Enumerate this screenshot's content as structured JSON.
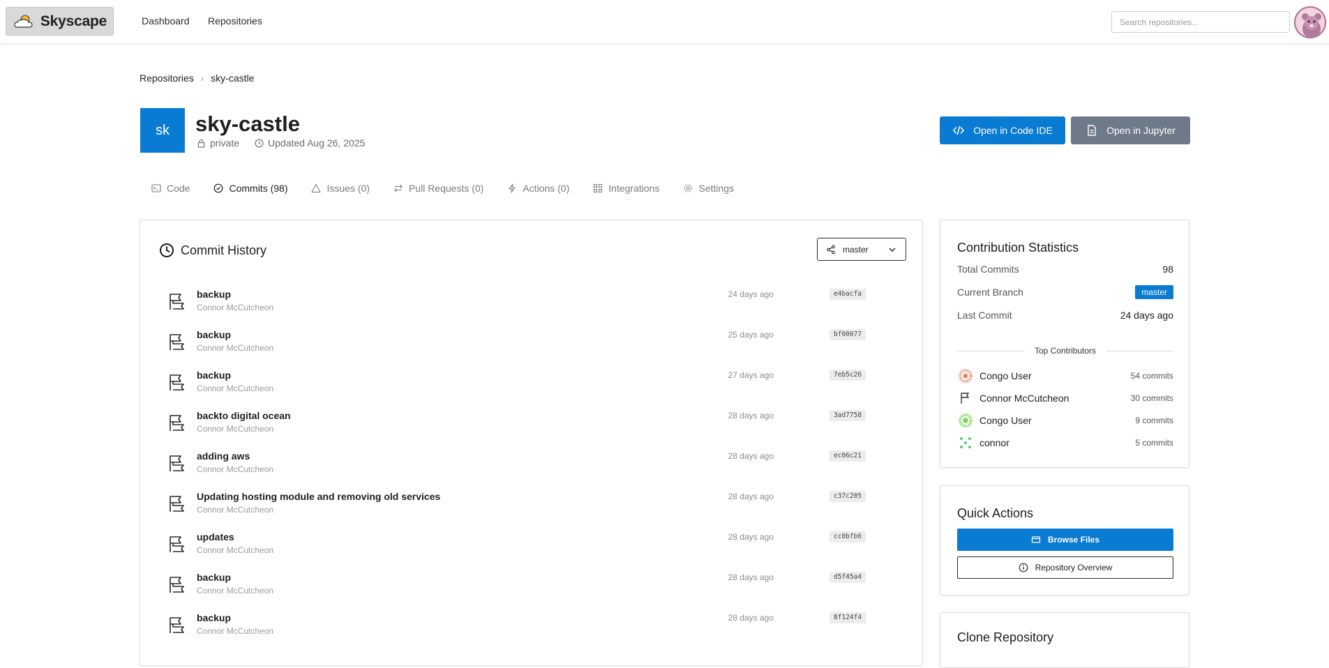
{
  "app": {
    "name": "Skyscape"
  },
  "nav": {
    "items": [
      {
        "label": "Dashboard"
      },
      {
        "label": "Repositories"
      }
    ],
    "search_placeholder": "Search repositories..."
  },
  "breadcrumb": {
    "parent": "Repositories",
    "separator": "›",
    "current": "sky-castle"
  },
  "repo": {
    "initials": "sk",
    "name": "sky-castle",
    "visibility": "private",
    "updated": "Updated Aug 26, 2025",
    "actions": {
      "ide_label": "Open in Code IDE",
      "jupyter_label": "Open in Jupyter"
    }
  },
  "tabs": [
    {
      "label": "Code",
      "icon": "terminal-icon"
    },
    {
      "label": "Commits (98)",
      "icon": "check-circle-icon",
      "active": true
    },
    {
      "label": "Issues (0)",
      "icon": "warning-icon"
    },
    {
      "label": "Pull Requests (0)",
      "icon": "arrows-icon"
    },
    {
      "label": "Actions (0)",
      "icon": "bolt-icon"
    },
    {
      "label": "Integrations",
      "icon": "grid-icon"
    },
    {
      "label": "Settings",
      "icon": "gear-icon"
    }
  ],
  "commit_history": {
    "title": "Commit History",
    "branch": "master",
    "commits": [
      {
        "message": "backup",
        "author": "Connor McCutcheon",
        "time": "24 days ago",
        "sha": "e4bacfa"
      },
      {
        "message": "backup",
        "author": "Connor McCutcheon",
        "time": "25 days ago",
        "sha": "bf00077"
      },
      {
        "message": "backup",
        "author": "Connor McCutcheon",
        "time": "27 days ago",
        "sha": "7eb5c26"
      },
      {
        "message": "backto digital ocean",
        "author": "Connor McCutcheon",
        "time": "28 days ago",
        "sha": "3ad7758"
      },
      {
        "message": "adding aws",
        "author": "Connor McCutcheon",
        "time": "28 days ago",
        "sha": "ec06c21"
      },
      {
        "message": "Updating hosting module and removing old services",
        "author": "Connor McCutcheon",
        "time": "28 days ago",
        "sha": "c37c205"
      },
      {
        "message": "updates",
        "author": "Connor McCutcheon",
        "time": "28 days ago",
        "sha": "cc0bfb6"
      },
      {
        "message": "backup",
        "author": "Connor McCutcheon",
        "time": "28 days ago",
        "sha": "d5f45a4"
      },
      {
        "message": "backup",
        "author": "Connor McCutcheon",
        "time": "28 days ago",
        "sha": "8f124f4"
      }
    ]
  },
  "stats": {
    "title": "Contribution Statistics",
    "total_commits_label": "Total Commits",
    "total_commits": "98",
    "current_branch_label": "Current Branch",
    "current_branch": "master",
    "last_commit_label": "Last Commit",
    "last_commit": "24 days ago",
    "top_contributors_label": "Top Contributors",
    "contributors": [
      {
        "name": "Congo User",
        "commits": "54 commits",
        "color": "#e07a5f"
      },
      {
        "name": "Connor McCutcheon",
        "commits": "30 commits",
        "color": "#333333"
      },
      {
        "name": "Congo User",
        "commits": "9 commits",
        "color": "#7ccf5a"
      },
      {
        "name": "connor",
        "commits": "5 commits",
        "color": "#4fd07a"
      }
    ]
  },
  "quick_actions": {
    "title": "Quick Actions",
    "browse_label": "Browse Files",
    "overview_label": "Repository Overview"
  },
  "clone": {
    "title": "Clone Repository"
  },
  "colors": {
    "primary": "#0a7bd3",
    "secondary": "#6f7a89"
  }
}
